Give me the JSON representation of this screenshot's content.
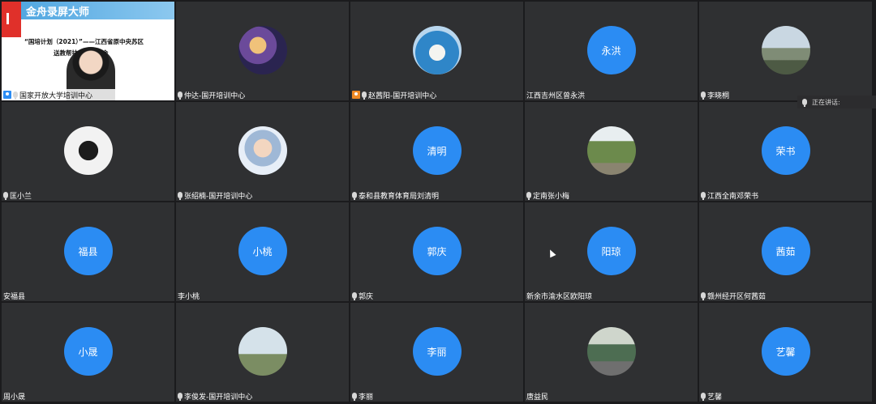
{
  "share": {
    "brand": "金舟录屏大师",
    "title_line1": "“国培计划（2021）”——江西省原中央苏区",
    "title_line2": "送教帮扶——调研会",
    "host_name": "国家开放大学培训中心"
  },
  "speaking_label": "正在讲话:",
  "tiles": [
    {
      "name": "仲达-国开培训中心",
      "initials": "",
      "img": "img-anime",
      "mic": true,
      "host": false
    },
    {
      "name": "赵茜阳-国开培训中心",
      "initials": "",
      "img": "img-blue",
      "mic": true,
      "host": true
    },
    {
      "name": "江西吉州区曾永洪",
      "initials": "永洪",
      "img": "",
      "mic": false,
      "host": false
    },
    {
      "name": "李晓桐",
      "initials": "",
      "img": "img-mountain",
      "mic": true,
      "host": false
    },
    {
      "name": "匡小兰",
      "initials": "",
      "img": "img-phone",
      "mic": true,
      "host": false
    },
    {
      "name": "张绍楠-国开培训中心",
      "initials": "",
      "img": "img-girl",
      "mic": true,
      "host": false
    },
    {
      "name": "泰和县教育体育局刘清明",
      "initials": "清明",
      "img": "",
      "mic": true,
      "host": false
    },
    {
      "name": "定南张小梅",
      "initials": "",
      "img": "img-park",
      "mic": true,
      "host": false
    },
    {
      "name": "江西全南邓荣书",
      "initials": "荣书",
      "img": "",
      "mic": true,
      "host": false
    },
    {
      "name": "安福县",
      "initials": "福县",
      "img": "",
      "mic": false,
      "host": false
    },
    {
      "name": "李小桃",
      "initials": "小桃",
      "img": "",
      "mic": false,
      "host": false
    },
    {
      "name": "郭庆",
      "initials": "郭庆",
      "img": "",
      "mic": true,
      "host": false
    },
    {
      "name": "新余市渝水区欧阳琼",
      "initials": "阳琼",
      "img": "",
      "mic": false,
      "host": false
    },
    {
      "name": "赣州经开区何茜茹",
      "initials": "茜茹",
      "img": "",
      "mic": true,
      "host": false
    },
    {
      "name": "周小晟",
      "initials": "小晟",
      "img": "",
      "mic": false,
      "host": false
    },
    {
      "name": "李俊发-国开培训中心",
      "initials": "",
      "img": "img-sky",
      "mic": true,
      "host": false
    },
    {
      "name": "李丽",
      "initials": "李丽",
      "img": "",
      "mic": true,
      "host": false
    },
    {
      "name": "唐益民",
      "initials": "",
      "img": "img-person",
      "mic": false,
      "host": false
    },
    {
      "name": "艺馨",
      "initials": "艺馨",
      "img": "",
      "mic": true,
      "host": false
    }
  ]
}
